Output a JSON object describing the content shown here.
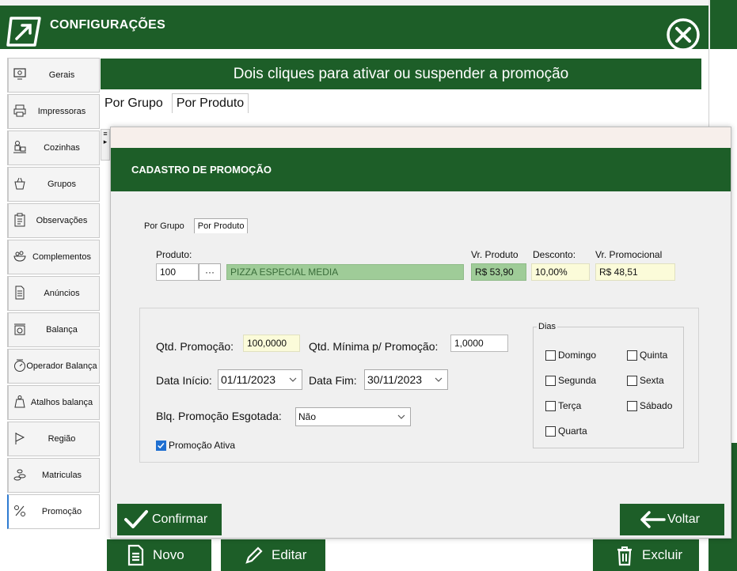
{
  "window": {
    "title": "CONFIGURAÇÕES"
  },
  "sidebar": {
    "items": [
      {
        "label": "Gerais"
      },
      {
        "label": "Impressoras"
      },
      {
        "label": "Cozinhas"
      },
      {
        "label": "Grupos"
      },
      {
        "label": "Observações"
      },
      {
        "label": "Complementos"
      },
      {
        "label": "Anúncios"
      },
      {
        "label": "Balança"
      },
      {
        "label": "Operador Balança"
      },
      {
        "label": "Atalhos balança"
      },
      {
        "label": "Região"
      },
      {
        "label": "Matriculas"
      },
      {
        "label": "Promoção"
      }
    ]
  },
  "page": {
    "banner": "Dois cliques para ativar ou suspender a promoção",
    "tabs": [
      "Por Grupo",
      "Por Produto"
    ],
    "bottom_buttons": {
      "novo": "Novo",
      "editar": "Editar",
      "excluir": "Excluir"
    }
  },
  "modal": {
    "title": "CADASTRO DE PROMOÇÃO",
    "tabs": [
      "Por Grupo",
      "Por Produto"
    ],
    "produto_label": "Produto:",
    "produto_code": "100",
    "ellipsis": "···",
    "produto_name": "PIZZA ESPECIAL MEDIA",
    "vr_produto_label": "Vr. Produto",
    "vr_produto": "R$ 53,90",
    "desconto_label": "Desconto:",
    "desconto": "10,00%",
    "vr_promocional_label": "Vr. Promocional",
    "vr_promocional": "R$ 48,51",
    "qtd_promocao_label": "Qtd. Promoção:",
    "qtd_promocao": "100,0000",
    "qtd_minima_label": "Qtd. Mínima p/ Promoção:",
    "qtd_minima": "1,0000",
    "data_inicio_label": "Data Início:",
    "data_inicio": "01/11/2023",
    "data_fim_label": "Data Fim:",
    "data_fim": "30/11/2023",
    "blq_label": "Blq. Promoção Esgotada:",
    "blq_value": "Não",
    "promocao_ativa_label": "Promoção Ativa",
    "dias_title": "Dias",
    "dias": [
      "Domingo",
      "Quinta",
      "Segunda",
      "Sexta",
      "Terça",
      "Sábado",
      "Quarta"
    ],
    "confirmar": "Confirmar",
    "voltar": "Voltar"
  },
  "colors": {
    "brand_green": "#1d5e28",
    "field_yellow": "#fbfbd9",
    "field_green": "#9fcc98",
    "checkbox_blue": "#1f6fd1"
  }
}
